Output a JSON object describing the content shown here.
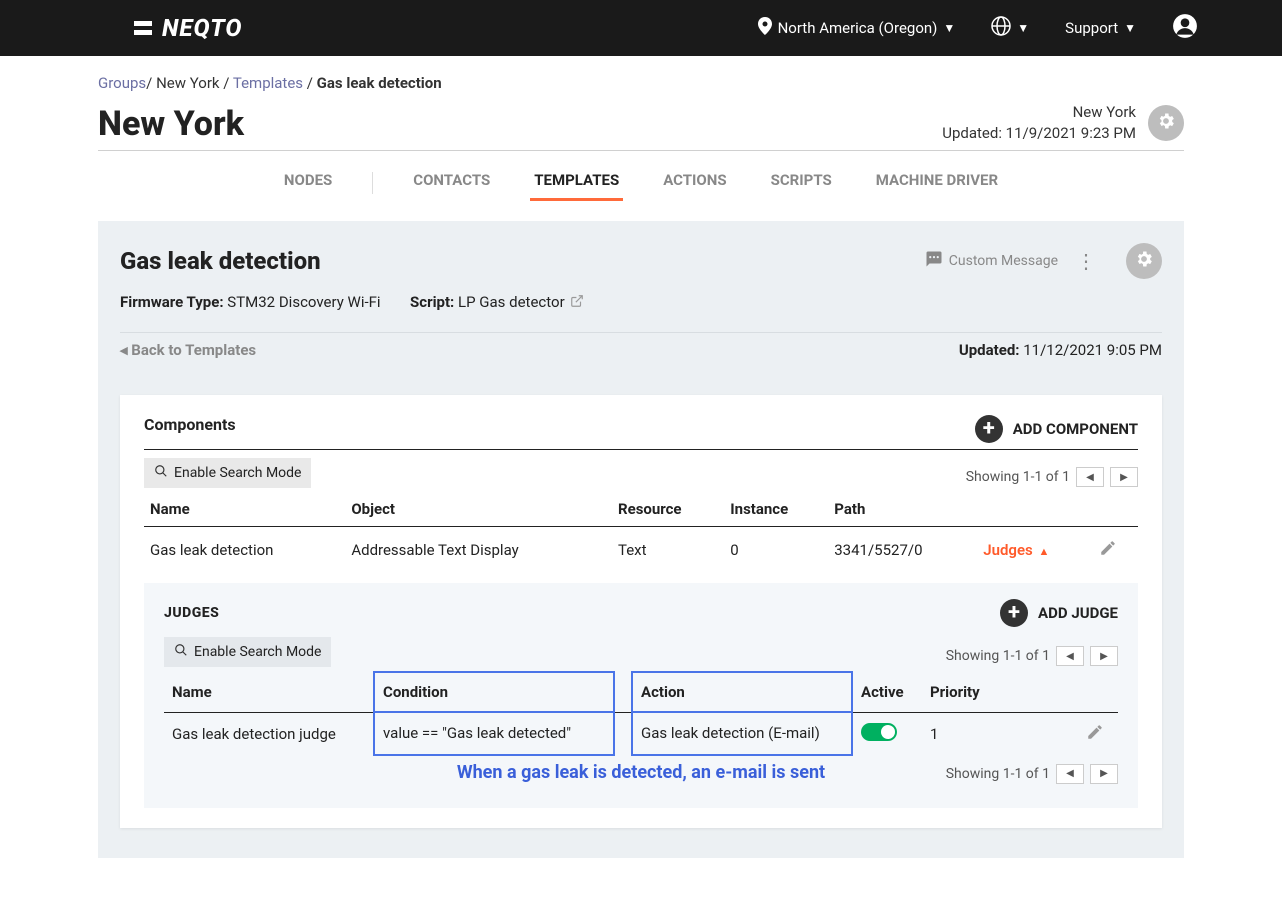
{
  "topbar": {
    "brand": "NEQTO",
    "region": "North America (Oregon)",
    "support": "Support"
  },
  "breadcrumb": {
    "groups": "Groups",
    "group": "New York",
    "templates": "Templates",
    "current": "Gas leak detection"
  },
  "title": {
    "heading": "New York",
    "meta_group": "New York",
    "updated": "Updated: 11/9/2021 9:23 PM"
  },
  "tabs": {
    "nodes": "NODES",
    "contacts": "CONTACTS",
    "templates": "TEMPLATES",
    "actions": "ACTIONS",
    "scripts": "SCRIPTS",
    "machine_driver": "MACHINE DRIVER"
  },
  "panel": {
    "title": "Gas leak detection",
    "custom_message": "Custom Message",
    "firmware_label": "Firmware Type:",
    "firmware_value": "STM32 Discovery Wi-Fi",
    "script_label": "Script:",
    "script_value": "LP Gas detector",
    "back": "◂ Back to Templates",
    "updated_label": "Updated:",
    "updated_value": "11/12/2021 9:05 PM"
  },
  "components": {
    "title": "Components",
    "add": "ADD COMPONENT",
    "showing": "Showing 1-1 of 1",
    "search": "Enable Search Mode",
    "headers": {
      "name": "Name",
      "object": "Object",
      "resource": "Resource",
      "instance": "Instance",
      "path": "Path"
    },
    "row": {
      "name": "Gas leak detection",
      "object": "Addressable Text Display",
      "resource": "Text",
      "instance": "0",
      "path": "3341/5527/0",
      "judges": "Judges"
    }
  },
  "judges": {
    "title": "JUDGES",
    "add": "ADD JUDGE",
    "showing": "Showing 1-1 of 1",
    "search": "Enable Search Mode",
    "headers": {
      "name": "Name",
      "condition": "Condition",
      "action": "Action",
      "active": "Active",
      "priority": "Priority"
    },
    "row": {
      "name": "Gas leak detection judge",
      "condition": "value == \"Gas leak detected\"",
      "action": "Gas leak detection (E-mail)",
      "priority": "1"
    },
    "annotation": "When a gas leak is detected, an e-mail is sent",
    "showing_bottom": "Showing 1-1 of 1"
  }
}
